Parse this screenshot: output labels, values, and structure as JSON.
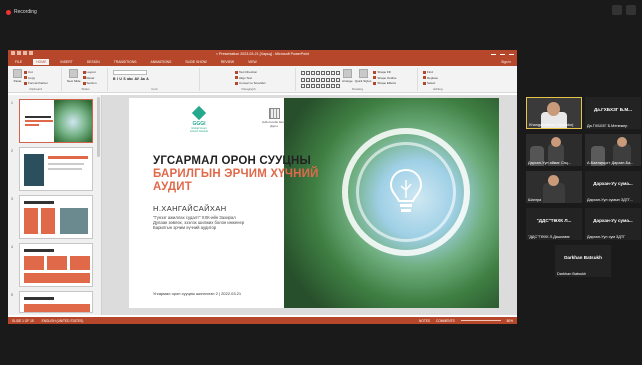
{
  "recording": {
    "label": "Recording"
  },
  "app": {
    "title": "< Presentation 2023-03-21 [Харьц] - Microsoft PowerPoint",
    "tabs": [
      "FILE",
      "HOME",
      "INSERT",
      "DESIGN",
      "TRANSITIONS",
      "ANIMATIONS",
      "SLIDE SHOW",
      "REVIEW",
      "VIEW"
    ],
    "active_tab": "HOME",
    "sign_in": "Sign in",
    "ribbon": {
      "clipboard": {
        "label": "Clipboard",
        "paste": "Paste",
        "items": [
          "Cut",
          "Copy",
          "Format Painter"
        ]
      },
      "slides": {
        "label": "Slides",
        "new_slide": "New Slide",
        "items": [
          "Layout",
          "Reset",
          "Section"
        ]
      },
      "font": {
        "label": "Font",
        "format": [
          "B",
          "I",
          "U",
          "S",
          "abc",
          "AV",
          "Aa",
          "A"
        ]
      },
      "paragraph": {
        "label": "Paragraph",
        "items": [
          "Text Direction",
          "Align Text",
          "Convert to SmartArt"
        ]
      },
      "drawing": {
        "label": "Drawing",
        "arrange": "Arrange",
        "quick_styles": "Quick Styles",
        "items": [
          "Shape Fill",
          "Shape Outline",
          "Shape Effects"
        ]
      },
      "editing": {
        "label": "Editing",
        "items": [
          "Find",
          "Replace",
          "Select"
        ]
      }
    },
    "status": {
      "slide": "SLIDE 1 OF 15",
      "language": "ENGLISH (UNITED STATES)",
      "notes": "NOTES",
      "comments": "COMMENTS",
      "zoom": "80%"
    }
  },
  "thumbnails": [
    {
      "num": "1",
      "selected": true
    },
    {
      "num": "2",
      "selected": false
    },
    {
      "num": "3",
      "selected": false
    },
    {
      "num": "4",
      "selected": false
    },
    {
      "num": "5",
      "selected": false
    }
  ],
  "slide": {
    "logo_main": "GGGI",
    "logo_main_sub": "Global Green Growth Institute",
    "logo_second": "Нийслэлийн Засаг Дарга",
    "title_line1": "УГСАРМАЛ ОРОН СУУЦНЫ",
    "title_line2": "БАРИЛГЫН ЭРЧИМ ХҮЧНИЙ",
    "title_line3": "АУДИТ",
    "author": "Н.ХАНГАЙСАЙХАН",
    "roles": [
      "\"Гүнзэг ажиллах судалт\" ХХК-ийн Захирал",
      "Дулаан зөвлөх, эзэлэх шилжих болон инженер",
      "Барилгын эрчим хүчний аудитор"
    ],
    "footer": "Угсармал орон сууцны шинэчлэл 2 | 2022.03.21"
  },
  "participants": [
    {
      "name": "Khangaisaikhan Nyamdorj",
      "display": "",
      "active": true
    },
    {
      "name": "Да.ГХБХЗГ Б.Менежер",
      "display": "Да.ГХБХЗГ Б.М...",
      "active": false
    },
    {
      "name": "Дархан-Уул аймаг Сэц...",
      "display": "",
      "active": false
    },
    {
      "name": "А.Баатарцогт Дархан-Ба...",
      "display": "",
      "active": false
    },
    {
      "name": "Шангра",
      "display": "",
      "active": false
    },
    {
      "name": "Дархан-Уул сумын ЗДТГ...",
      "display": "Дархан-Уу сума...",
      "active": false
    },
    {
      "name": "\"ДДС\"ТӨХК Л.Дашзэвэг",
      "display": "\"ДДС\"ТӨХК Л...",
      "active": false
    },
    {
      "name": "Дархан-Уул сум ЗДТГ",
      "display": "Дархан-Уу сума...",
      "active": false
    },
    {
      "name": "Darkhan Batsukh",
      "display": "Darkhan Batsukh",
      "active": false
    }
  ],
  "colors": {
    "ppt_accent": "#b7472a",
    "title_orange": "#e0694a",
    "gggi_green": "#24a98e"
  }
}
